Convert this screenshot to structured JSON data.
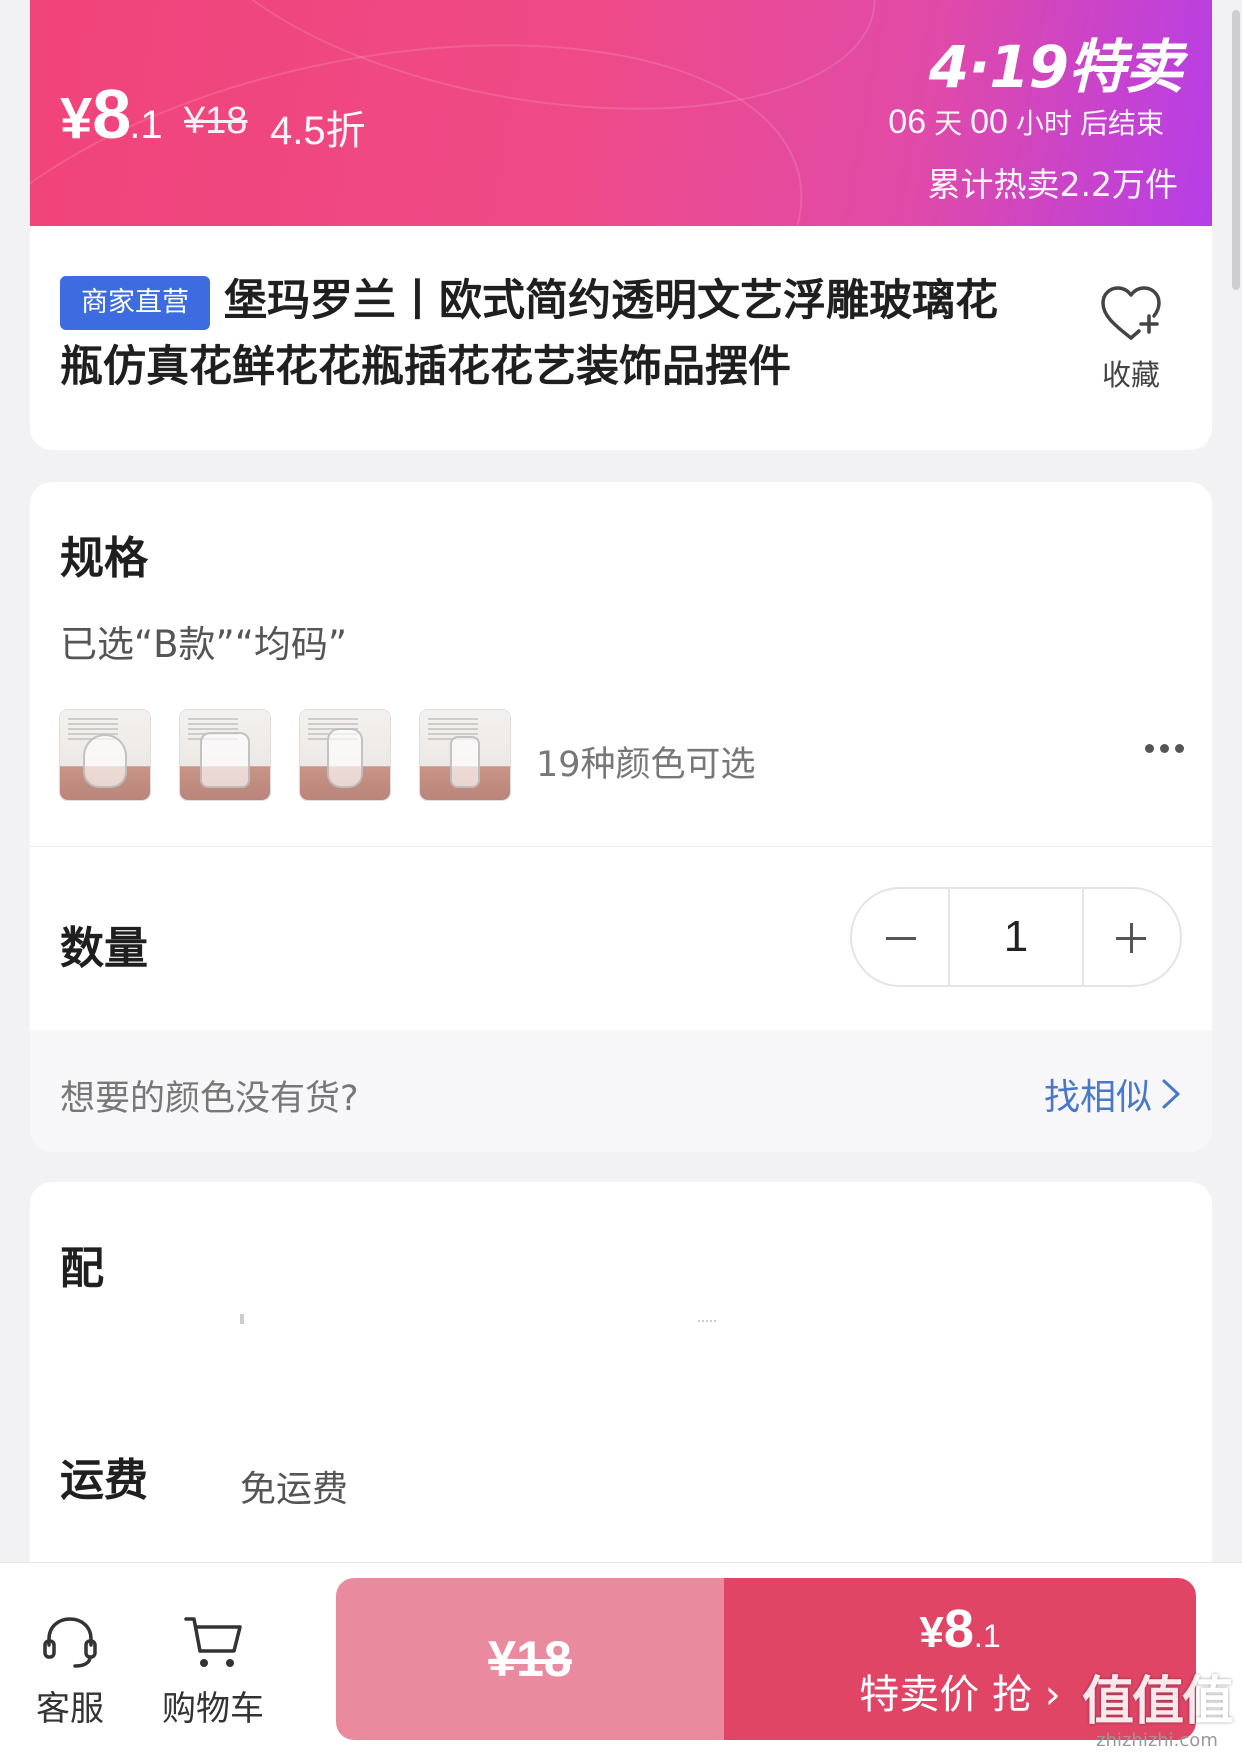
{
  "promo": {
    "price_currency": "¥",
    "price_int": "8",
    "price_dec": ".1",
    "original_price": "¥18",
    "discount": "4.5折",
    "sale_title": "4·19特卖",
    "countdown": {
      "days": "06",
      "days_unit": "天",
      "hours": "00",
      "hours_unit": "小时",
      "suffix": "后结束"
    },
    "sold_count": "累计热卖2.2万件",
    "gradient_colors": [
      "#f0437a",
      "#e04aa8",
      "#b63ee8"
    ]
  },
  "product": {
    "badge": "商家直营",
    "title": "堡玛罗兰丨欧式简约透明文艺浮雕玻璃花瓶仿真花鲜花花瓶插花花艺装饰品摆件",
    "favorite_label": "收藏",
    "favorite_icon": "heart-plus-icon"
  },
  "spec": {
    "heading": "规格",
    "selected": "已选“B款”“均码”",
    "thumbnails": [
      "vase-a",
      "vase-b",
      "vase-c",
      "vase-d"
    ],
    "colors_available": "19种颜色可选",
    "more_icon": "more-dots-icon"
  },
  "quantity": {
    "heading": "数量",
    "value": "1"
  },
  "no_stock": {
    "question": "想要的颜色没有货?",
    "find_similar": "找相似"
  },
  "delivery": {
    "heading": "配",
    "fee_heading": "运费",
    "fee_value": "免运费"
  },
  "bottom_bar": {
    "service_label": "客服",
    "cart_label": "购物车",
    "original_price": "¥18",
    "sale_currency": "¥",
    "sale_int": "8",
    "sale_dec": ".1",
    "sale_label": "特卖价 抢",
    "colors": {
      "original_btn": "#e98a9e",
      "sale_btn": "#e04566"
    }
  },
  "watermark": {
    "logo": "值值值",
    "url": "zhizhizhi.com"
  }
}
